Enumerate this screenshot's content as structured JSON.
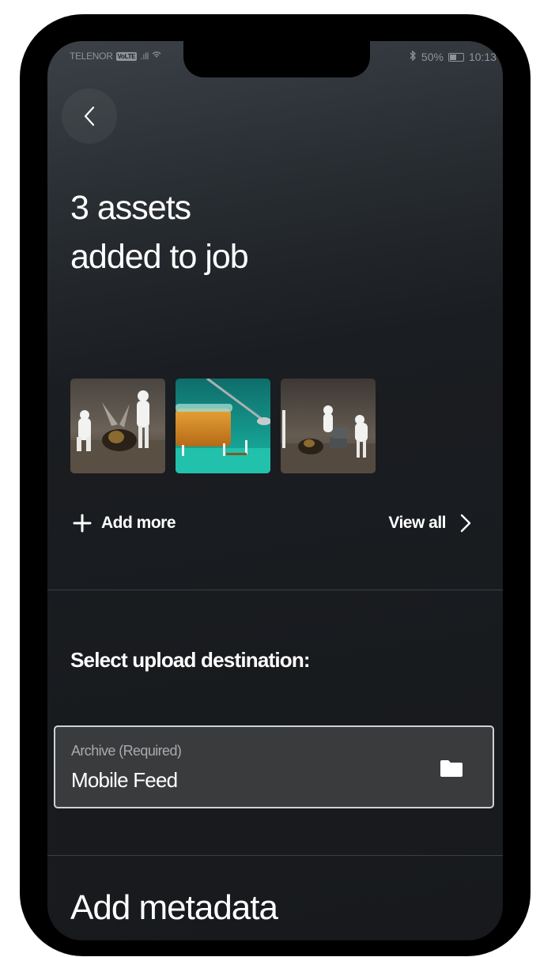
{
  "status_bar": {
    "carrier": "TELENOR",
    "volte": "VoLTE",
    "signal": ".ıll",
    "bluetooth": "✱",
    "battery_percent": "50%",
    "time": "10:13"
  },
  "header": {
    "back_icon": "chevron-left-icon",
    "title_line1": "3 assets",
    "title_line2": "added to job"
  },
  "assets": {
    "thumbnails": [
      {
        "icon": "bee-figurines-photo"
      },
      {
        "icon": "honey-jar-photo"
      },
      {
        "icon": "bee-laptop-photo"
      }
    ],
    "add_more_label": "Add more",
    "view_all_label": "View all"
  },
  "upload": {
    "section_label": "Select upload destination:",
    "field_label": "Archive (Required)",
    "field_value": "Mobile Feed",
    "field_icon": "folder-icon"
  },
  "metadata": {
    "title": "Add metadata"
  }
}
